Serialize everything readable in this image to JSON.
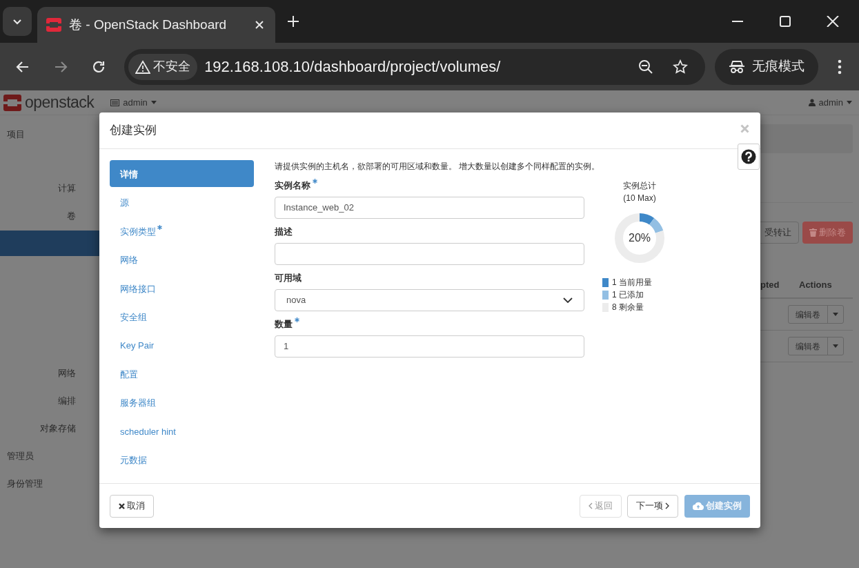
{
  "browser": {
    "tabs": [
      {
        "title": "卷 - OpenStack Dashboard",
        "selected": true
      }
    ],
    "security": "不安全",
    "url": "192.168.108.10/dashboard/project/volumes/",
    "incognito": "无痕模式"
  },
  "page": {
    "logo": "openstack",
    "project_menu": "admin",
    "user_menu": "admin",
    "sidebar": [
      {
        "label": "项目",
        "kind": "section"
      },
      {
        "label": "计算",
        "kind": "group"
      },
      {
        "label": "卷",
        "kind": "group"
      },
      {
        "label": "网络",
        "kind": "group"
      },
      {
        "label": "编排",
        "kind": "group"
      },
      {
        "label": "对象存储",
        "kind": "group"
      },
      {
        "label": "管理员",
        "kind": "section"
      },
      {
        "label": "身份管理",
        "kind": "section"
      }
    ],
    "toolbar": [
      {
        "label": "受转让",
        "kind": "default"
      },
      {
        "label": "删除卷",
        "kind": "danger"
      }
    ],
    "columns": [
      "pted",
      "Actions"
    ],
    "rows": [
      {
        "action": "编辑卷"
      },
      {
        "action": "编辑卷"
      }
    ]
  },
  "modal": {
    "title": "创建实例",
    "steps": [
      {
        "label": "详情",
        "required": false,
        "selected": true
      },
      {
        "label": "源",
        "required": false,
        "selected": false
      },
      {
        "label": "实例类型",
        "required": true,
        "selected": false
      },
      {
        "label": "网络",
        "required": false,
        "selected": false
      },
      {
        "label": "网络接口",
        "required": false,
        "selected": false
      },
      {
        "label": "安全组",
        "required": false,
        "selected": false
      },
      {
        "label": "Key Pair",
        "required": false,
        "selected": false
      },
      {
        "label": "配置",
        "required": false,
        "selected": false
      },
      {
        "label": "服务器组",
        "required": false,
        "selected": false
      },
      {
        "label": "scheduler hint",
        "required": false,
        "selected": false
      },
      {
        "label": "元数据",
        "required": false,
        "selected": false
      }
    ],
    "intro": "请提供实例的主机名，欲部署的可用区域和数量。 增大数量以创建多个同样配置的实例。",
    "fields": [
      {
        "label": "实例名称",
        "required": true,
        "kind": "text",
        "value": "Instance_web_02"
      },
      {
        "label": "描述",
        "required": false,
        "kind": "text"
      },
      {
        "label": "可用域",
        "required": false,
        "kind": "select",
        "value": "nova"
      },
      {
        "label": "数量",
        "required": true,
        "kind": "text",
        "value": "1"
      }
    ],
    "quota": {
      "title": "实例总计",
      "subtitle": "(10 Max)",
      "percent": "20%",
      "legend": [
        {
          "count": "1",
          "label": "当前用量",
          "color": "#3f88c8"
        },
        {
          "count": "1",
          "label": "已添加",
          "color": "#93bfe3"
        },
        {
          "count": "8",
          "label": "剩余量",
          "color": "#ececec"
        }
      ]
    },
    "buttons": [
      {
        "label": "取消",
        "kind": "cancel",
        "disabled": false
      },
      {
        "label": "返回",
        "kind": "back",
        "disabled": true
      },
      {
        "label": "下一项",
        "kind": "next",
        "disabled": false
      },
      {
        "label": "创建实例",
        "kind": "create",
        "disabled": true
      }
    ]
  }
}
